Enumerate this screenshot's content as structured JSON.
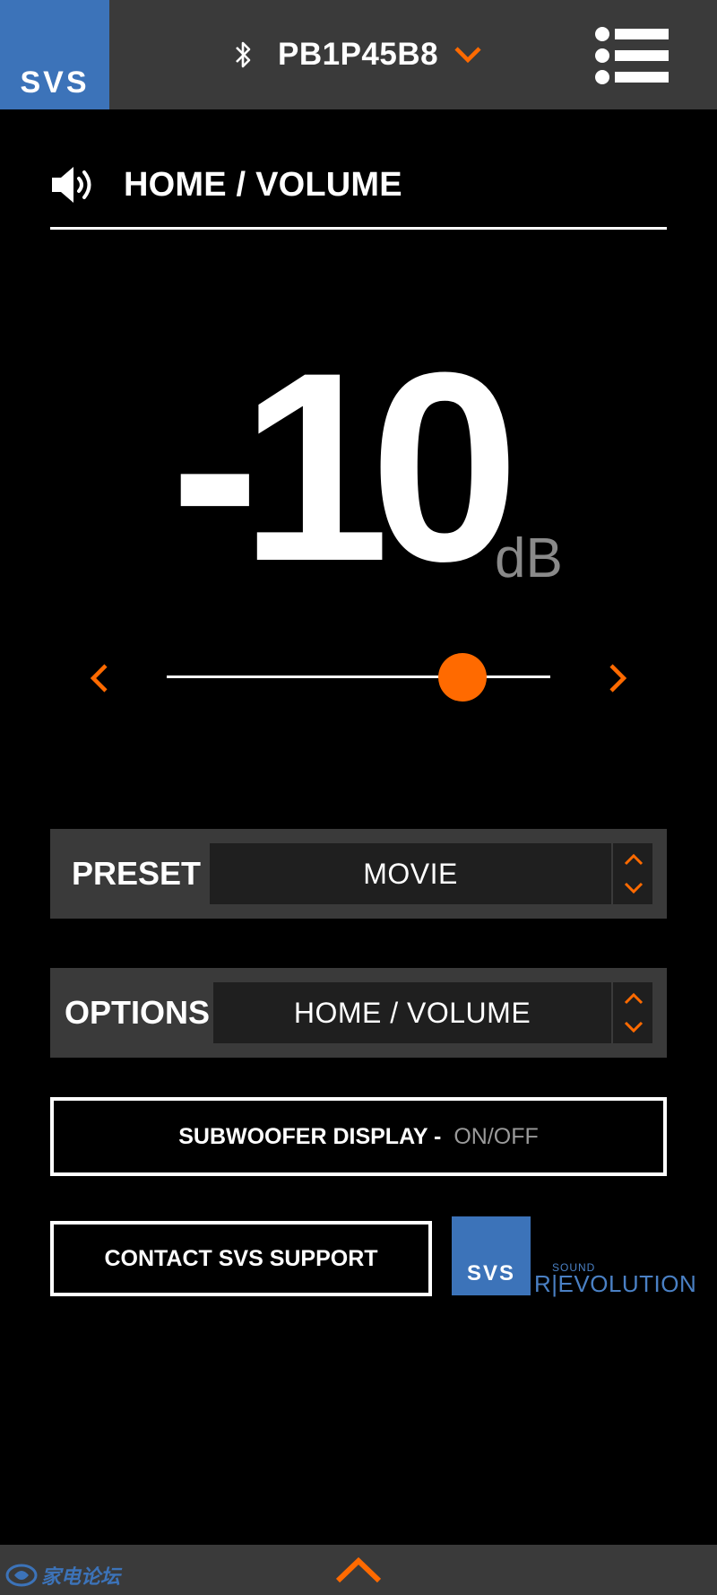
{
  "header": {
    "logo_text": "SVS",
    "device_name": "PB1P45B8",
    "icons": {
      "bluetooth": "bluetooth-icon",
      "dropdown": "chevron-down-icon",
      "menu": "menu-list-icon"
    }
  },
  "section": {
    "title": "HOME / VOLUME",
    "icon": "speaker-volume-icon"
  },
  "volume": {
    "value": "-10",
    "unit": "dB",
    "slider_fraction": 0.77
  },
  "preset": {
    "label": "PRESET",
    "value": "MOVIE"
  },
  "options": {
    "label": "OPTIONS",
    "value": "HOME / VOLUME"
  },
  "subwoofer_display": {
    "label_bold": "SUBWOOFER DISPLAY -",
    "label_light": "ON/OFF"
  },
  "support": {
    "label": "CONTACT SVS SUPPORT"
  },
  "brand": {
    "logo_text": "SVS",
    "sound": "SOUND",
    "revolution": "R|EVOLUTION"
  },
  "watermark": {
    "text": "家电论坛"
  },
  "colors": {
    "accent": "#ff6a00",
    "brand_blue": "#3c73b9",
    "bar_gray": "#3a3a3a"
  }
}
